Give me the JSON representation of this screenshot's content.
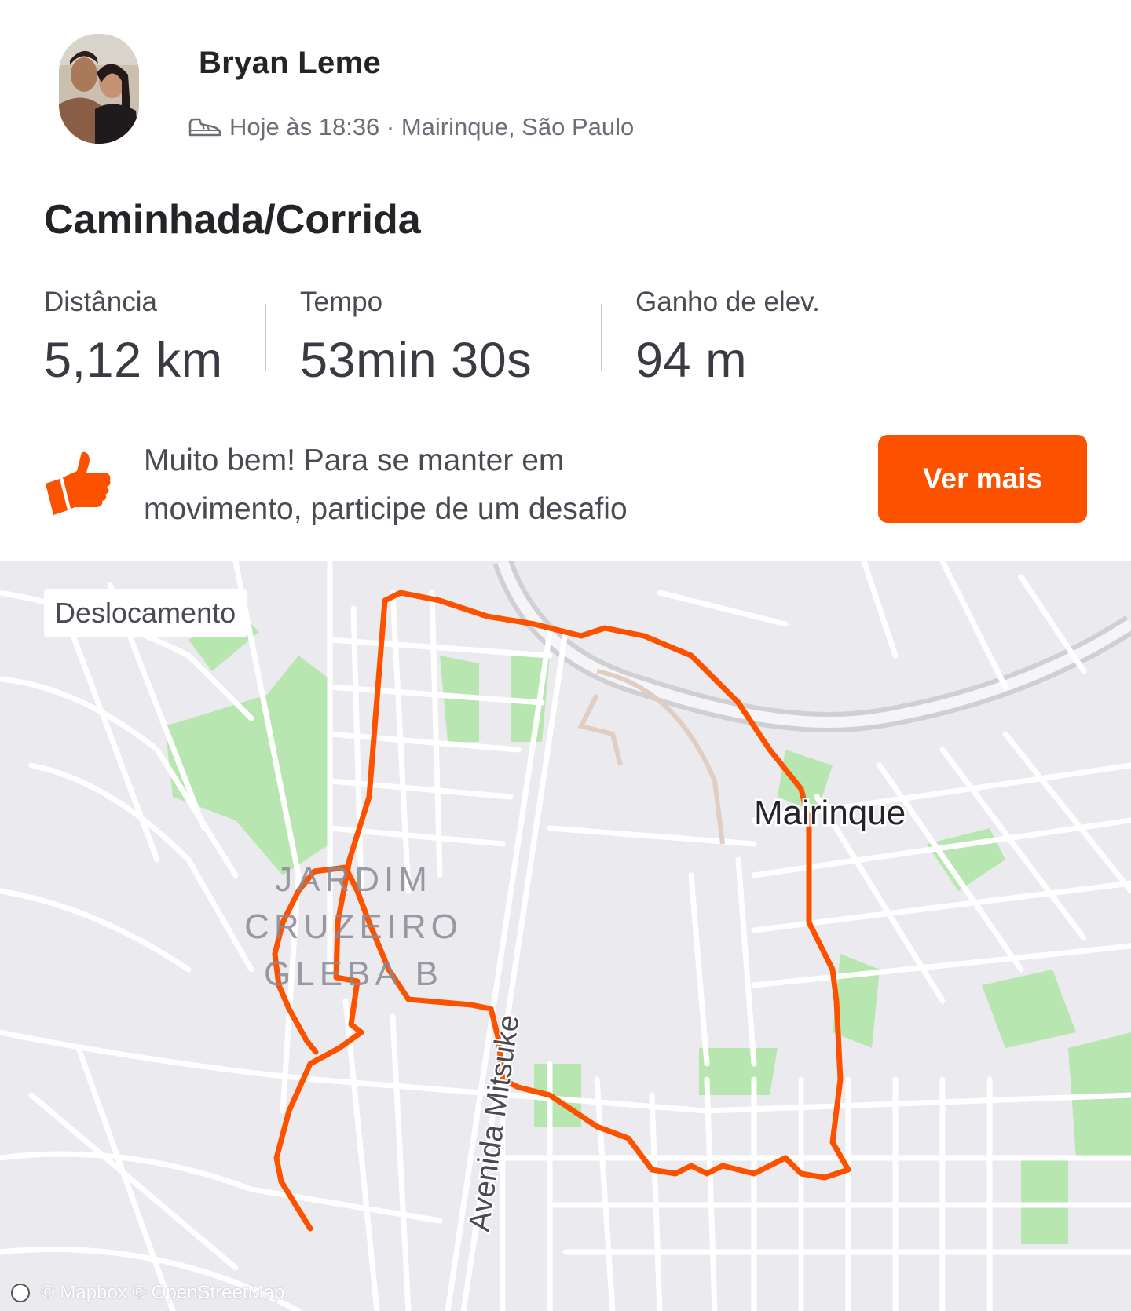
{
  "athlete": {
    "name": "Bryan Leme",
    "meta": "Hoje às 18:36 · Mairinque, São Paulo",
    "activity_icon": "shoe-icon"
  },
  "activity": {
    "title": "Caminhada/Corrida"
  },
  "stats": [
    {
      "label": "Distância",
      "value": "5,12 km"
    },
    {
      "label": "Tempo",
      "value": "53min 30s"
    },
    {
      "label": "Ganho de elev.",
      "value": "94 m"
    }
  ],
  "cta": {
    "icon": "thumbs-up-icon",
    "text_line1": "Muito bem! Para se manter em",
    "text_line2": "movimento, participe de um desafio",
    "button_label": "Ver mais"
  },
  "map": {
    "badge": "Deslocamento",
    "city_label": "Mairinque",
    "district_line1": "JARDIM",
    "district_line2": "CRUZEIRO",
    "district_line3": "GLEBA B",
    "street_label": "Avenida Mitsuke",
    "attribution": "© Mapbox © OpenStreetMap",
    "route_color": "#fc5200",
    "park_color": "#b8e6b0"
  }
}
